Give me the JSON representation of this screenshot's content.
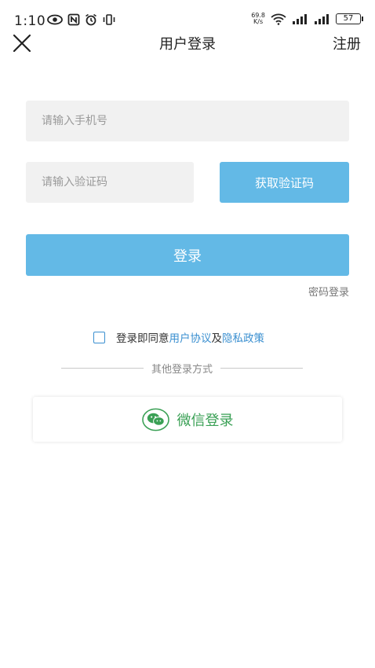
{
  "status_bar": {
    "time": "1:10",
    "net_speed_value": "69.8",
    "net_speed_unit": "K/s",
    "battery": "57"
  },
  "nav": {
    "title": "用户登录",
    "register": "注册"
  },
  "form": {
    "phone_placeholder": "请输入手机号",
    "code_placeholder": "请输入验证码",
    "get_code": "获取验证码",
    "login": "登录",
    "password_login": "密码登录"
  },
  "agreement": {
    "prefix": "登录即同意",
    "user_agreement": "用户协议",
    "and": "及",
    "privacy_policy": "隐私政策"
  },
  "other_login": {
    "divider_label": "其他登录方式",
    "wechat_label": "微信登录"
  },
  "colors": {
    "accent": "#63b9e6",
    "link": "#3a8fd0",
    "wechat": "#3aa055"
  }
}
